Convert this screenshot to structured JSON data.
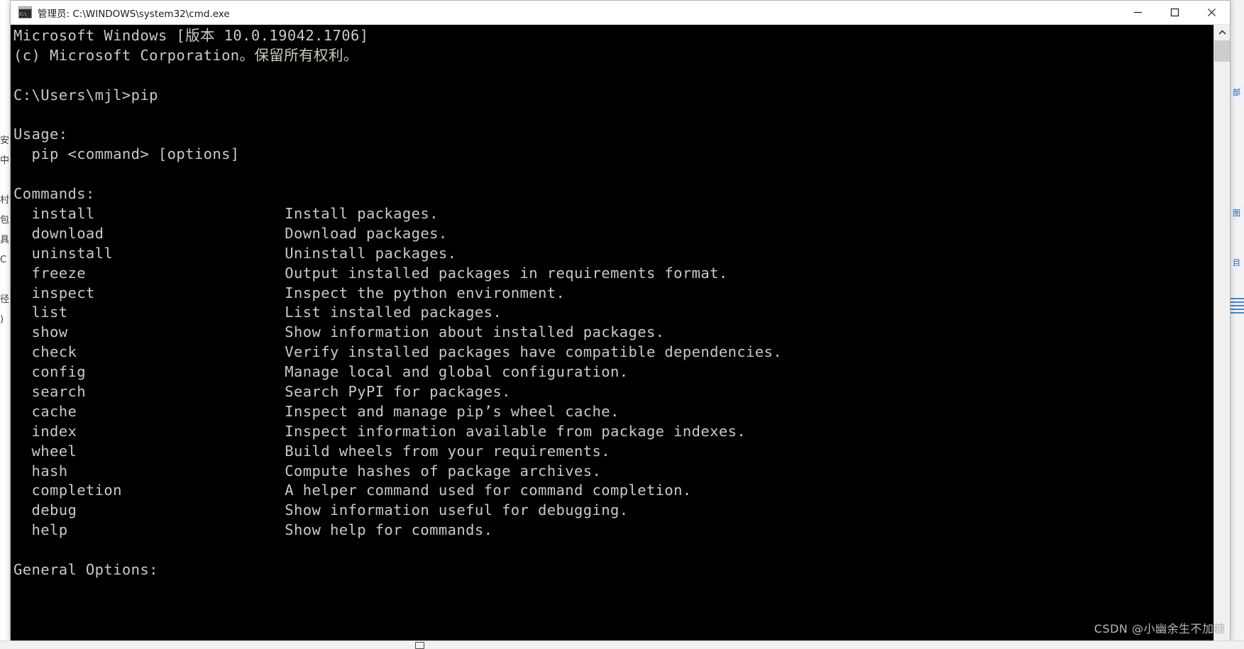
{
  "window": {
    "title": "管理员: C:\\WINDOWS\\system32\\cmd.exe",
    "icon": "cmd-icon",
    "icon_glyph": "C:\\",
    "minimize_label": "最小化",
    "maximize_label": "最大化",
    "close_label": "关闭"
  },
  "console": {
    "background_color": "#000000",
    "text_color": "#ccc9c2",
    "lines": [
      "Microsoft Windows [版本 10.0.19042.1706]",
      "(c) Microsoft Corporation。保留所有权利。",
      "",
      "C:\\Users\\mjl>pip",
      "",
      "Usage:",
      "  pip <command> [options]",
      "",
      "Commands:",
      "  install                     Install packages.",
      "  download                    Download packages.",
      "  uninstall                   Uninstall packages.",
      "  freeze                      Output installed packages in requirements format.",
      "  inspect                     Inspect the python environment.",
      "  list                        List installed packages.",
      "  show                        Show information about installed packages.",
      "  check                       Verify installed packages have compatible dependencies.",
      "  config                      Manage local and global configuration.",
      "  search                      Search PyPI for packages.",
      "  cache                       Inspect and manage pip’s wheel cache.",
      "  index                       Inspect information available from package indexes.",
      "  wheel                       Build wheels from your requirements.",
      "  hash                        Compute hashes of package archives.",
      "  completion                  A helper command used for command completion.",
      "  debug                       Show information useful for debugging.",
      "  help                        Show help for commands.",
      "",
      "General Options:"
    ],
    "commands": [
      {
        "name": "install",
        "description": "Install packages."
      },
      {
        "name": "download",
        "description": "Download packages."
      },
      {
        "name": "uninstall",
        "description": "Uninstall packages."
      },
      {
        "name": "freeze",
        "description": "Output installed packages in requirements format."
      },
      {
        "name": "inspect",
        "description": "Inspect the python environment."
      },
      {
        "name": "list",
        "description": "List installed packages."
      },
      {
        "name": "show",
        "description": "Show information about installed packages."
      },
      {
        "name": "check",
        "description": "Verify installed packages have compatible dependencies."
      },
      {
        "name": "config",
        "description": "Manage local and global configuration."
      },
      {
        "name": "search",
        "description": "Search PyPI for packages."
      },
      {
        "name": "cache",
        "description": "Inspect and manage pip’s wheel cache."
      },
      {
        "name": "index",
        "description": "Inspect information available from package indexes."
      },
      {
        "name": "wheel",
        "description": "Build wheels from your requirements."
      },
      {
        "name": "hash",
        "description": "Compute hashes of package archives."
      },
      {
        "name": "completion",
        "description": "A helper command used for command completion."
      },
      {
        "name": "debug",
        "description": "Show information useful for debugging."
      },
      {
        "name": "help",
        "description": "Show help for commands."
      }
    ],
    "headings": {
      "usage": "Usage:",
      "commands": "Commands:",
      "general_options": "General Options:"
    },
    "prompt": "C:\\Users\\mjl>",
    "typed_command": "pip",
    "usage_line": "  pip <command> [options]",
    "banner": [
      "Microsoft Windows [版本 10.0.19042.1706]",
      "(c) Microsoft Corporation。保留所有权利。"
    ]
  },
  "scrollbar": {
    "up_arrow": "scroll-up-arrow",
    "thumb_label": "scroll-thumb"
  },
  "watermark": "CSDN @小幽余生不加糖",
  "background": {
    "left_glyphs": "安\n中\n\n村\n包\n具\nC\n\n径\n)",
    "right_chip_1": "部",
    "right_chip_2": "图",
    "right_chip_3": "目"
  }
}
